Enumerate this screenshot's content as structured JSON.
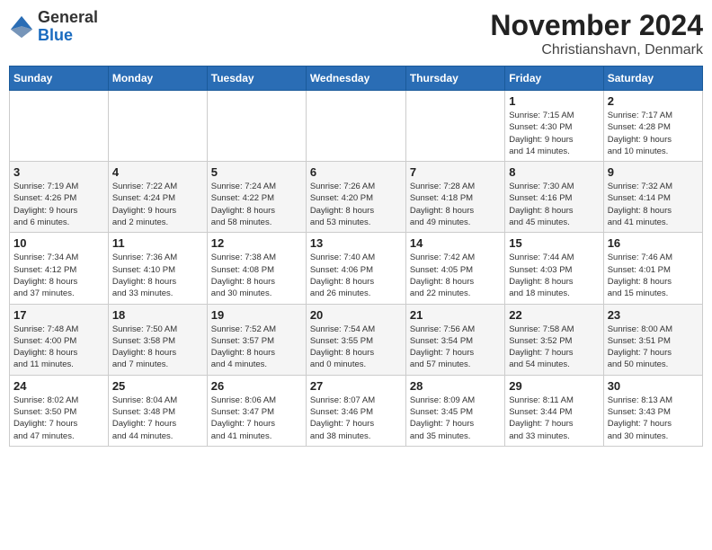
{
  "logo": {
    "general": "General",
    "blue": "Blue"
  },
  "title": {
    "month_year": "November 2024",
    "location": "Christianshavn, Denmark"
  },
  "weekdays": [
    "Sunday",
    "Monday",
    "Tuesday",
    "Wednesday",
    "Thursday",
    "Friday",
    "Saturday"
  ],
  "weeks": [
    [
      {
        "day": "",
        "info": ""
      },
      {
        "day": "",
        "info": ""
      },
      {
        "day": "",
        "info": ""
      },
      {
        "day": "",
        "info": ""
      },
      {
        "day": "",
        "info": ""
      },
      {
        "day": "1",
        "info": "Sunrise: 7:15 AM\nSunset: 4:30 PM\nDaylight: 9 hours\nand 14 minutes."
      },
      {
        "day": "2",
        "info": "Sunrise: 7:17 AM\nSunset: 4:28 PM\nDaylight: 9 hours\nand 10 minutes."
      }
    ],
    [
      {
        "day": "3",
        "info": "Sunrise: 7:19 AM\nSunset: 4:26 PM\nDaylight: 9 hours\nand 6 minutes."
      },
      {
        "day": "4",
        "info": "Sunrise: 7:22 AM\nSunset: 4:24 PM\nDaylight: 9 hours\nand 2 minutes."
      },
      {
        "day": "5",
        "info": "Sunrise: 7:24 AM\nSunset: 4:22 PM\nDaylight: 8 hours\nand 58 minutes."
      },
      {
        "day": "6",
        "info": "Sunrise: 7:26 AM\nSunset: 4:20 PM\nDaylight: 8 hours\nand 53 minutes."
      },
      {
        "day": "7",
        "info": "Sunrise: 7:28 AM\nSunset: 4:18 PM\nDaylight: 8 hours\nand 49 minutes."
      },
      {
        "day": "8",
        "info": "Sunrise: 7:30 AM\nSunset: 4:16 PM\nDaylight: 8 hours\nand 45 minutes."
      },
      {
        "day": "9",
        "info": "Sunrise: 7:32 AM\nSunset: 4:14 PM\nDaylight: 8 hours\nand 41 minutes."
      }
    ],
    [
      {
        "day": "10",
        "info": "Sunrise: 7:34 AM\nSunset: 4:12 PM\nDaylight: 8 hours\nand 37 minutes."
      },
      {
        "day": "11",
        "info": "Sunrise: 7:36 AM\nSunset: 4:10 PM\nDaylight: 8 hours\nand 33 minutes."
      },
      {
        "day": "12",
        "info": "Sunrise: 7:38 AM\nSunset: 4:08 PM\nDaylight: 8 hours\nand 30 minutes."
      },
      {
        "day": "13",
        "info": "Sunrise: 7:40 AM\nSunset: 4:06 PM\nDaylight: 8 hours\nand 26 minutes."
      },
      {
        "day": "14",
        "info": "Sunrise: 7:42 AM\nSunset: 4:05 PM\nDaylight: 8 hours\nand 22 minutes."
      },
      {
        "day": "15",
        "info": "Sunrise: 7:44 AM\nSunset: 4:03 PM\nDaylight: 8 hours\nand 18 minutes."
      },
      {
        "day": "16",
        "info": "Sunrise: 7:46 AM\nSunset: 4:01 PM\nDaylight: 8 hours\nand 15 minutes."
      }
    ],
    [
      {
        "day": "17",
        "info": "Sunrise: 7:48 AM\nSunset: 4:00 PM\nDaylight: 8 hours\nand 11 minutes."
      },
      {
        "day": "18",
        "info": "Sunrise: 7:50 AM\nSunset: 3:58 PM\nDaylight: 8 hours\nand 7 minutes."
      },
      {
        "day": "19",
        "info": "Sunrise: 7:52 AM\nSunset: 3:57 PM\nDaylight: 8 hours\nand 4 minutes."
      },
      {
        "day": "20",
        "info": "Sunrise: 7:54 AM\nSunset: 3:55 PM\nDaylight: 8 hours\nand 0 minutes."
      },
      {
        "day": "21",
        "info": "Sunrise: 7:56 AM\nSunset: 3:54 PM\nDaylight: 7 hours\nand 57 minutes."
      },
      {
        "day": "22",
        "info": "Sunrise: 7:58 AM\nSunset: 3:52 PM\nDaylight: 7 hours\nand 54 minutes."
      },
      {
        "day": "23",
        "info": "Sunrise: 8:00 AM\nSunset: 3:51 PM\nDaylight: 7 hours\nand 50 minutes."
      }
    ],
    [
      {
        "day": "24",
        "info": "Sunrise: 8:02 AM\nSunset: 3:50 PM\nDaylight: 7 hours\nand 47 minutes."
      },
      {
        "day": "25",
        "info": "Sunrise: 8:04 AM\nSunset: 3:48 PM\nDaylight: 7 hours\nand 44 minutes."
      },
      {
        "day": "26",
        "info": "Sunrise: 8:06 AM\nSunset: 3:47 PM\nDaylight: 7 hours\nand 41 minutes."
      },
      {
        "day": "27",
        "info": "Sunrise: 8:07 AM\nSunset: 3:46 PM\nDaylight: 7 hours\nand 38 minutes."
      },
      {
        "day": "28",
        "info": "Sunrise: 8:09 AM\nSunset: 3:45 PM\nDaylight: 7 hours\nand 35 minutes."
      },
      {
        "day": "29",
        "info": "Sunrise: 8:11 AM\nSunset: 3:44 PM\nDaylight: 7 hours\nand 33 minutes."
      },
      {
        "day": "30",
        "info": "Sunrise: 8:13 AM\nSunset: 3:43 PM\nDaylight: 7 hours\nand 30 minutes."
      }
    ]
  ]
}
